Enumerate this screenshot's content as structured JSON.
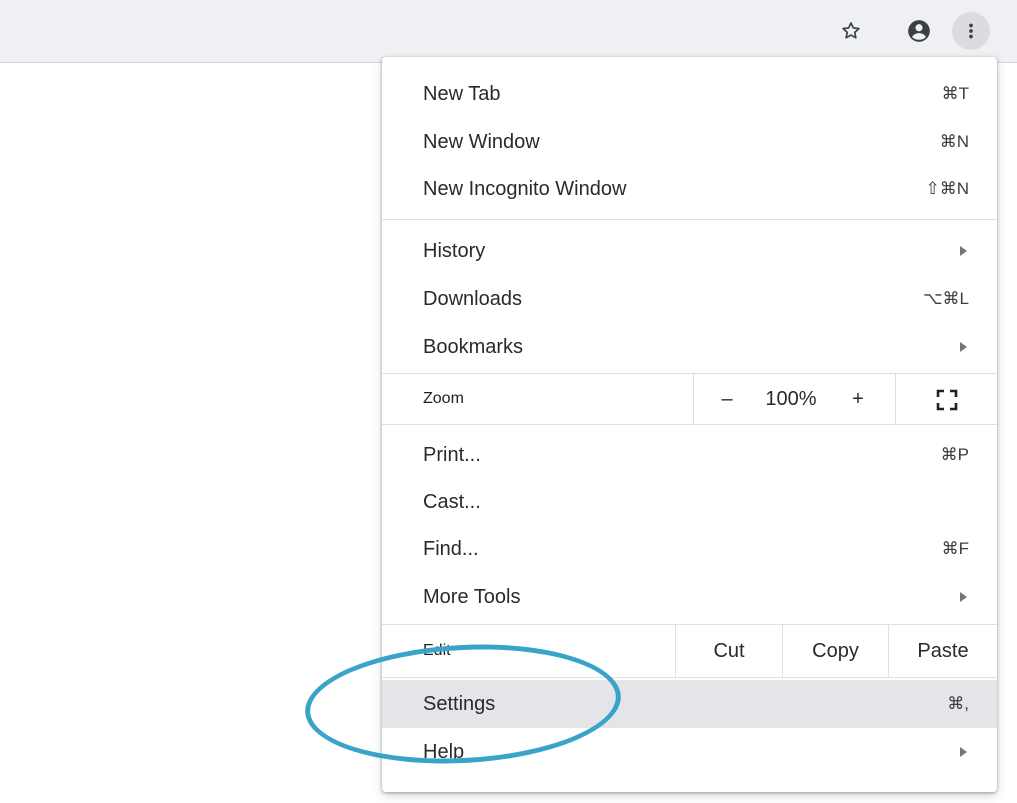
{
  "menu": {
    "group1": [
      {
        "label": "New Tab",
        "shortcut": "⌘T"
      },
      {
        "label": "New Window",
        "shortcut": "⌘N"
      },
      {
        "label": "New Incognito Window",
        "shortcut": "⇧⌘N"
      }
    ],
    "group2": [
      {
        "label": "History",
        "submenu": true
      },
      {
        "label": "Downloads",
        "shortcut": "⌥⌘L"
      },
      {
        "label": "Bookmarks",
        "submenu": true
      }
    ],
    "zoom": {
      "label": "Zoom",
      "minus": "–",
      "value": "100%",
      "plus": "+"
    },
    "group3": [
      {
        "label": "Print...",
        "shortcut": "⌘P"
      },
      {
        "label": "Cast..."
      },
      {
        "label": "Find...",
        "shortcut": "⌘F"
      },
      {
        "label": "More Tools",
        "submenu": true
      }
    ],
    "edit": {
      "label": "Edit",
      "cut": "Cut",
      "copy": "Copy",
      "paste": "Paste"
    },
    "settings": {
      "label": "Settings",
      "shortcut": "⌘,",
      "highlighted": true
    },
    "help": {
      "label": "Help",
      "submenu": true
    }
  },
  "toolbar_icons": [
    "star-icon",
    "account-icon",
    "more-vert-icon"
  ],
  "colors": {
    "annotation_circle": "#3aa3c9",
    "highlight": "#e4e5e8",
    "toolbar_bg": "#eef0f3"
  }
}
